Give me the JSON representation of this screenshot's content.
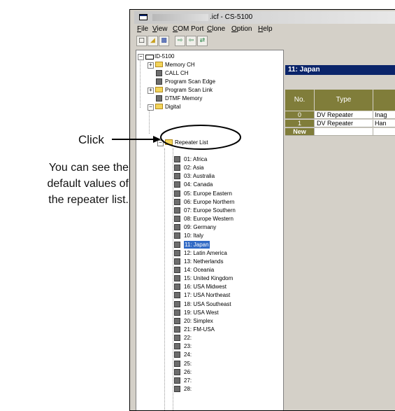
{
  "annotation": {
    "click": "Click",
    "note_lines": [
      "You can see the",
      "default values of",
      "the repeater list."
    ]
  },
  "window": {
    "title": ".icf - CS-5100"
  },
  "menu": [
    "File",
    "View",
    "COM Port",
    "Clone",
    "Option",
    "Help"
  ],
  "toolbar": [
    "new-icon",
    "open-icon",
    "save-icon",
    "read-from-radio-icon",
    "write-to-radio-icon",
    "clone-icon"
  ],
  "tree": {
    "root": "ID-5100",
    "top_items": [
      "Memory CH",
      "CALL CH",
      "Program Scan Edge",
      "Program Scan Link",
      "DTMF Memory",
      "Digital"
    ],
    "repeater_list": "Repeater List",
    "groups": [
      "01: Africa",
      "02: Asia",
      "03: Australia",
      "04: Canada",
      "05: Europe Eastern",
      "06: Europe Northern",
      "07: Europe Southern",
      "08: Europe Western",
      "09: Germany",
      "10: Italy",
      "11: Japan",
      "12: Latin America",
      "13: Netherlands",
      "14: Oceania",
      "15: United Kingdom",
      "16: USA Midwest",
      "17: USA Northeast",
      "18: USA Southeast",
      "19: USA West",
      "20: Simplex",
      "21: FM-USA",
      "22:",
      "23:",
      "24:",
      "25:",
      "26:",
      "27:",
      "28:"
    ],
    "selected": "11: Japan"
  },
  "panel": {
    "header": "11: Japan",
    "columns": [
      "No.",
      "Type"
    ],
    "rows": [
      {
        "no": "0",
        "type": "DV Repeater",
        "name": "Inag"
      },
      {
        "no": "1",
        "type": "DV Repeater",
        "name": "Han"
      },
      {
        "no": "New",
        "type": "",
        "name": ""
      }
    ]
  },
  "colors": {
    "header_blue": "#0a246a",
    "column_olive": "#807d3a",
    "selection": "#316ac5"
  }
}
